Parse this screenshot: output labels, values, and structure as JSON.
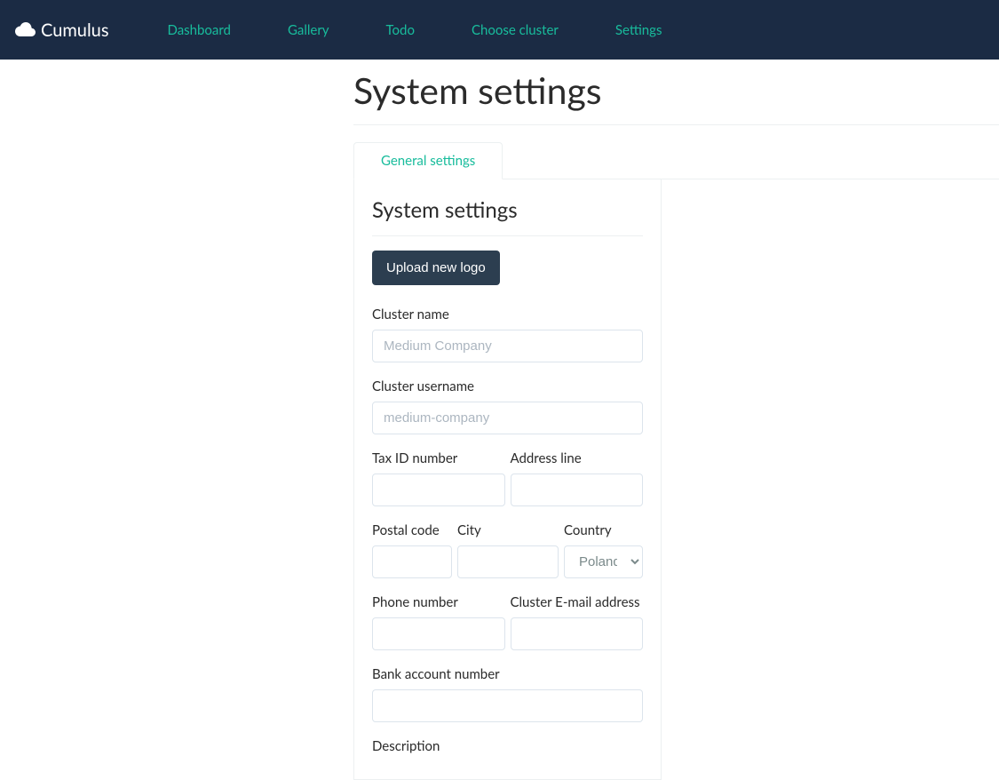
{
  "brand": {
    "name": "Cumulus"
  },
  "nav": {
    "items": [
      {
        "label": "Dashboard"
      },
      {
        "label": "Gallery"
      },
      {
        "label": "Todo"
      },
      {
        "label": "Choose cluster"
      },
      {
        "label": "Settings"
      }
    ]
  },
  "page": {
    "title": "System settings"
  },
  "tabs": {
    "active": "General settings"
  },
  "panel": {
    "title": "System settings",
    "upload_button": "Upload new logo"
  },
  "form": {
    "cluster_name": {
      "label": "Cluster name",
      "placeholder": "Medium Company",
      "value": ""
    },
    "cluster_username": {
      "label": "Cluster username",
      "placeholder": "medium-company",
      "value": ""
    },
    "tax_id": {
      "label": "Tax ID number",
      "value": ""
    },
    "address_line": {
      "label": "Address line",
      "value": ""
    },
    "postal_code": {
      "label": "Postal code",
      "value": ""
    },
    "city": {
      "label": "City",
      "value": ""
    },
    "country": {
      "label": "Country",
      "selected": "Poland"
    },
    "phone": {
      "label": "Phone number",
      "value": ""
    },
    "email": {
      "label": "Cluster E-mail address",
      "value": ""
    },
    "bank_account": {
      "label": "Bank account number",
      "value": ""
    },
    "description": {
      "label": "Description",
      "value": ""
    }
  }
}
